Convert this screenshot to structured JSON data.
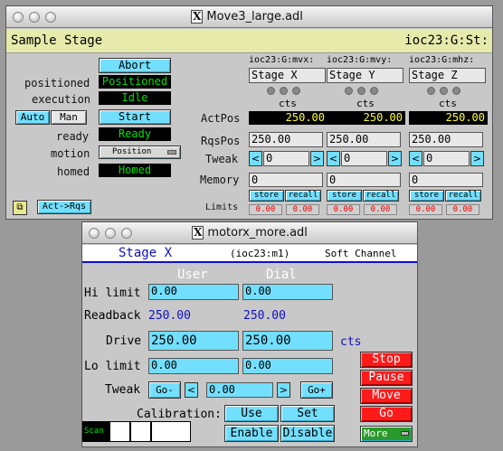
{
  "win1": {
    "title": "Move3_large.adl",
    "header_title": "Sample Stage",
    "header_prefix": "ioc23:G:St:",
    "status_labels": {
      "positioned": "positioned",
      "execution": "execution",
      "ready": "ready",
      "motion": "motion",
      "homed": "homed"
    },
    "status_values": {
      "positioned": "Positioned",
      "execution": "Idle",
      "ready": "Ready",
      "homed": "Homed"
    },
    "buttons": {
      "abort": "Abort",
      "start": "Start",
      "auto": "Auto",
      "man": "Man",
      "motion_mode": "Position",
      "act_rqs": "Act->Rqs"
    },
    "row_labels": {
      "actpos": "ActPos",
      "rqspos": "RqsPos",
      "tweak": "Tweak",
      "memory": "Memory",
      "limits": "Limits"
    },
    "axes": [
      {
        "pv": "ioc23:G:mvx:",
        "desc": "Stage X",
        "units": "cts",
        "actpos": "250.00",
        "rqspos": "250.00",
        "tweak": "0",
        "memory": "0",
        "store": "store",
        "recall": "recall",
        "limit_lo": "0.00",
        "limit_hi": "0.00"
      },
      {
        "pv": "ioc23:G:mvy:",
        "desc": "Stage Y",
        "units": "cts",
        "actpos": "250.00",
        "rqspos": "250.00",
        "tweak": "0",
        "memory": "0",
        "store": "store",
        "recall": "recall",
        "limit_lo": "0.00",
        "limit_hi": "0.00"
      },
      {
        "pv": "ioc23:G:mhz:",
        "desc": "Stage Z",
        "units": "cts",
        "actpos": "250.00",
        "rqspos": "250.00",
        "tweak": "0",
        "memory": "0",
        "store": "store",
        "recall": "recall",
        "limit_lo": "0.00",
        "limit_hi": "0.00"
      }
    ]
  },
  "win2": {
    "title": "motorx_more.adl",
    "header_desc": "Stage X",
    "header_pv": "(ioc23:m1)",
    "header_type": "Soft Channel",
    "col_user": "User",
    "col_dial": "Dial",
    "labels": {
      "hi_limit": "Hi limit",
      "readback": "Readback",
      "drive": "Drive",
      "lo_limit": "Lo limit",
      "tweak": "Tweak",
      "calibration": "Calibration:",
      "units": "cts"
    },
    "values": {
      "hi_user": "0.00",
      "hi_dial": "0.00",
      "rb_user": "250.00",
      "rb_dial": "250.00",
      "drive_user": "250.00",
      "drive_dial": "250.00",
      "lo_user": "0.00",
      "lo_dial": "0.00",
      "tweak_val": "0.00"
    },
    "buttons": {
      "stop": "Stop",
      "pause": "Pause",
      "move": "Move",
      "go": "Go",
      "tweak_minus": "Go-",
      "tweak_plus": "Go+",
      "use": "Use",
      "set": "Set",
      "enable": "Enable",
      "disable": "Disable",
      "more": "More",
      "scan": "Scan"
    }
  },
  "colors": {
    "accent": "#73dfff",
    "green_text": "#00e000",
    "alarm_red": "#ff1a1a",
    "title_blue": "#1010c0"
  },
  "icons": {
    "close": "window-close-icon",
    "x11": "x11-icon",
    "arrow_left": "left-arrow-icon",
    "arrow_right": "right-arrow-icon",
    "menu_indicator": "option-menu-icon"
  }
}
